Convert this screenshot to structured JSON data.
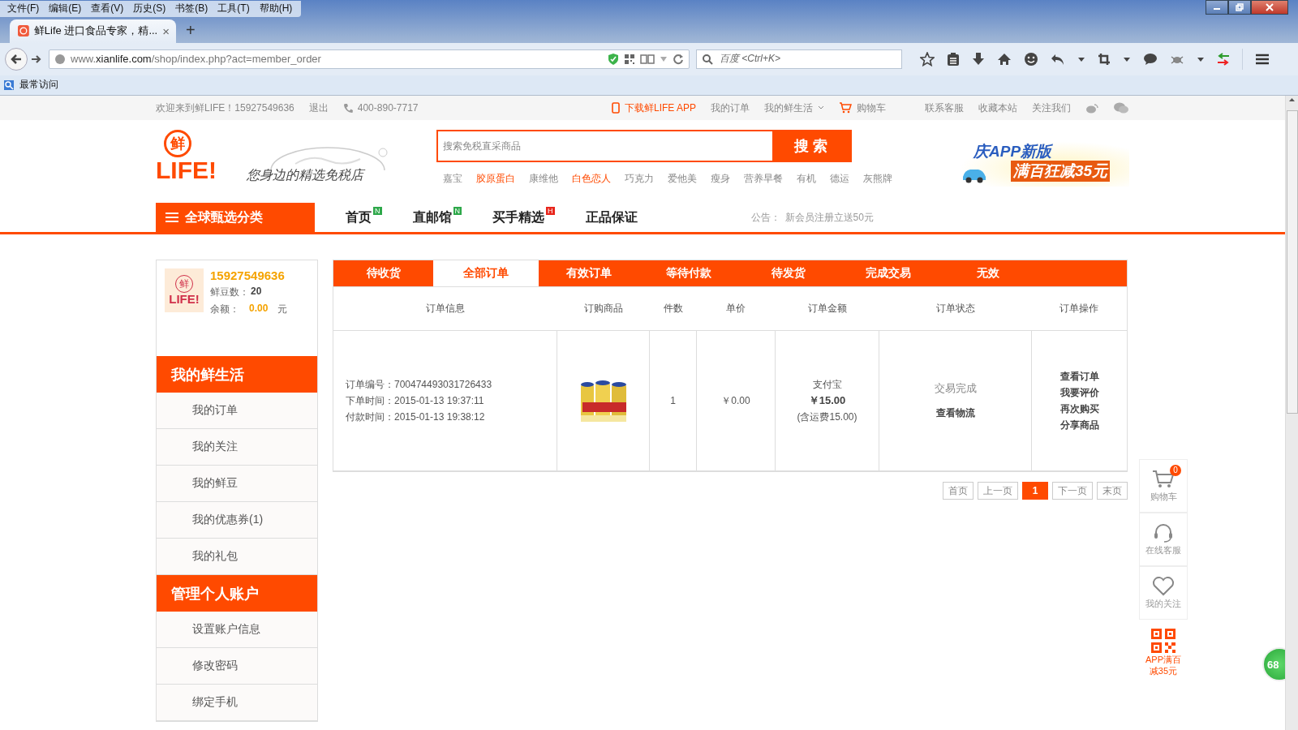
{
  "browser": {
    "menu": [
      "文件(F)",
      "编辑(E)",
      "查看(V)",
      "历史(S)",
      "书签(B)",
      "工具(T)",
      "帮助(H)"
    ],
    "tab": {
      "title": "鲜Life 进口食品专家，精...",
      "close": "×"
    },
    "new_tab": "+",
    "url": {
      "prefix": "www.",
      "host": "xianlife.com",
      "path": "/shop/index.php?act=member_order"
    },
    "search": {
      "placeholder": "百度 <Ctrl+K>"
    },
    "bookmarks": [
      "最常访问"
    ]
  },
  "topbar": {
    "welcome": "欢迎来到鲜LIFE！15927549636",
    "logout": "退出",
    "phone": "400-890-7717",
    "app": "下载鲜LIFE APP",
    "links": [
      "我的订单",
      "我的鲜生活"
    ],
    "cart": "购物车",
    "right_links": [
      "联系客服",
      "收藏本站",
      "关注我们"
    ]
  },
  "header": {
    "logo_badge": "鲜",
    "logo": "LIFE!",
    "slogan": "您身边的精选免税店",
    "search": {
      "placeholder": "搜索免税直采商品",
      "button": "搜 索"
    },
    "hot": [
      {
        "label": "嘉宝",
        "highlight": false
      },
      {
        "label": "胶原蛋白",
        "highlight": true
      },
      {
        "label": "康维他",
        "highlight": false
      },
      {
        "label": "白色恋人",
        "highlight": true
      },
      {
        "label": "巧克力",
        "highlight": false
      },
      {
        "label": "爱他美",
        "highlight": false
      },
      {
        "label": "瘦身",
        "highlight": false
      },
      {
        "label": "营养早餐",
        "highlight": false
      },
      {
        "label": "有机",
        "highlight": false
      },
      {
        "label": "德运",
        "highlight": false
      },
      {
        "label": "灰熊牌",
        "highlight": false
      }
    ],
    "banner": [
      "庆APP新版",
      "满百狂减35元"
    ]
  },
  "nav": {
    "category": "全球甄选分类",
    "items": [
      {
        "label": "首页",
        "tag": "N",
        "color": "#2ea84a"
      },
      {
        "label": "直邮馆",
        "tag": "N",
        "color": "#2ea84a"
      },
      {
        "label": "买手精选",
        "tag": "H",
        "color": "#e8261c"
      },
      {
        "label": "正品保证"
      }
    ],
    "notice_label": "公告：",
    "notice": "新会员注册立送50元"
  },
  "account": {
    "avatar_badge": "鲜",
    "avatar_text": "LIFE!",
    "username": "15927549636",
    "beans_label": "鲜豆数：",
    "beans": "20",
    "balance_label": "余额：",
    "balance": "0.00",
    "currency": "元"
  },
  "sidebar": [
    {
      "title": "我的鲜生活",
      "items": [
        "我的订单",
        "我的关注",
        "我的鲜豆",
        "我的优惠券(1)",
        "我的礼包"
      ]
    },
    {
      "title": "管理个人账户",
      "items": [
        "设置账户信息",
        "修改密码",
        "绑定手机"
      ]
    }
  ],
  "order_tabs": [
    {
      "label": "待收货",
      "selected": false
    },
    {
      "label": "全部订单",
      "selected": true
    },
    {
      "label": "有效订单",
      "selected": false
    },
    {
      "label": "等待付款",
      "selected": false
    },
    {
      "label": "待发货",
      "selected": false
    },
    {
      "label": "完成交易",
      "selected": false
    },
    {
      "label": "无效",
      "selected": false
    }
  ],
  "table": {
    "columns": [
      "订单信息",
      "订购商品",
      "件数",
      "单价",
      "订单金额",
      "订单状态",
      "订单操作"
    ],
    "rows": [
      {
        "info": [
          "订单编号：700474493031726433",
          "下单时间：2015-01-13 19:37:11",
          "付款时间：2015-01-13 19:38:12"
        ],
        "product": {
          "kind": "picture"
        },
        "quantity": "1",
        "unit_price": "￥0.00",
        "payment": "支付宝",
        "total": "￥15.00",
        "shipping_note": "(含运费15.00)",
        "status": "交易完成",
        "status_link": "查看物流",
        "actions": [
          "查看订单",
          "我要评价",
          "再次购买",
          "分享商品"
        ]
      }
    ]
  },
  "pagination": [
    {
      "label": "首页",
      "selected": false
    },
    {
      "label": "上一页",
      "selected": false
    },
    {
      "label": "1",
      "selected": true
    },
    {
      "label": "下一页",
      "selected": false
    },
    {
      "label": "末页",
      "selected": false
    }
  ],
  "float_panel": [
    {
      "kind": "cart",
      "label": "购物车",
      "count": "0"
    },
    {
      "kind": "headset",
      "label": "在线客服"
    },
    {
      "kind": "heart",
      "label": "我的关注"
    }
  ],
  "app_promo": [
    "APP满百",
    "减35元"
  ],
  "overlay_badge": "68"
}
